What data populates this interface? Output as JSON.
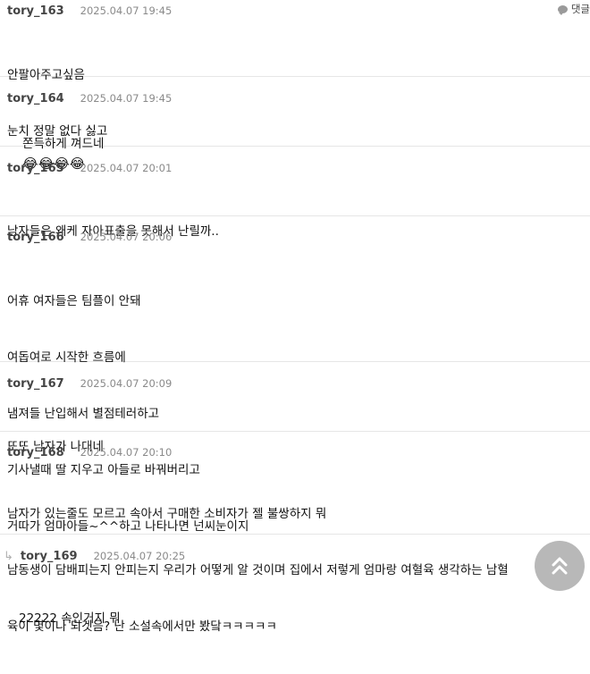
{
  "reply_label": "댓글",
  "comments": [
    {
      "author": "tory_163",
      "date": "2025.04.07 19:45",
      "lines": [
        "안팔아주고싶음",
        "눈치 정말 없다 싫고"
      ]
    },
    {
      "author": "tory_164",
      "date": "2025.04.07 19:45",
      "text": "쫀득하게 껴드네",
      "emojis": [
        "😂",
        "😂",
        "😂",
        "😂"
      ]
    },
    {
      "author": "tory_165",
      "date": "2025.04.07 20:01",
      "lines": [
        "남자들은 왜케 자아표출을 못해서 난릴까.."
      ]
    },
    {
      "author": "tory_166",
      "date": "2025.04.07 20:06",
      "lines": [
        "어휴 여자들은 팀플이 안돼",
        "여돕여로 시작한 흐름에",
        "냄져들 난입해서 별점테러하고",
        "기사낼때 딸 지우고 아들로 바꿔버리고",
        "거따가 엄마아들~^^하고 나타나면 넌씨눈이지"
      ]
    },
    {
      "author": "tory_167",
      "date": "2025.04.07 20:09",
      "lines": [
        "또또 남자가 나대네"
      ]
    },
    {
      "author": "tory_168",
      "date": "2025.04.07 20:10",
      "lines": [
        "남자가 있는줄도 모르고 속아서 구매한 소비자가 젤 불쌍하지 뭐",
        "남동생이 담배피는지 안피는지 우리가 어떻게 알 것이며 집에서 저렇게 엄마랑 여혈육 생각하는 남혈",
        "육이 몇이나 되겟음? 난 소설속에서만 봤닼ㅋㅋㅋㅋㅋ"
      ]
    },
    {
      "author": "tory_169",
      "date": "2025.04.07 20:25",
      "lines": [
        "22222 속인거지 뭐"
      ],
      "is_reply": true
    }
  ],
  "scroll_top_icon": "double-chevron-up-icon"
}
